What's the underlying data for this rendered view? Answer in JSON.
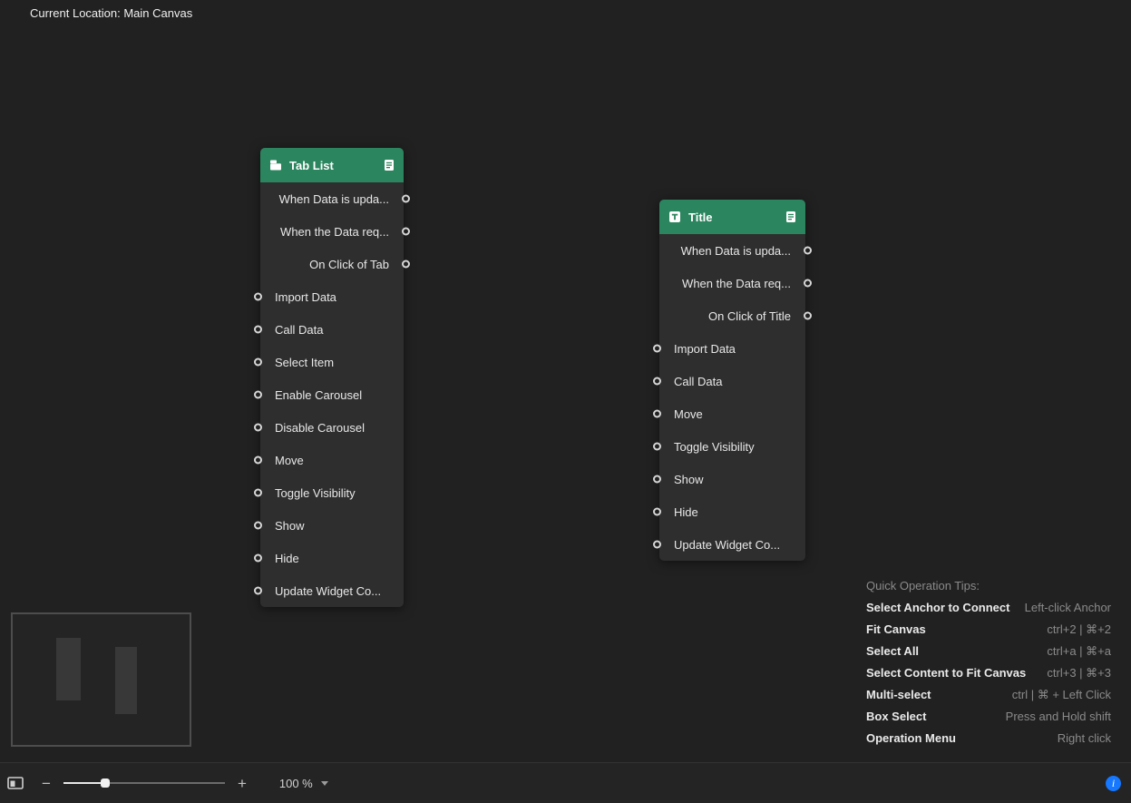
{
  "header": {
    "location": "Current Location: Main Canvas"
  },
  "nodes": [
    {
      "title": "Tab List",
      "icon": "tab-list-icon",
      "detail_icon": "document-icon",
      "outputs": [
        "When Data is upda...",
        "When the Data req...",
        "On Click of Tab"
      ],
      "inputs": [
        "Import Data",
        "Call Data",
        "Select Item",
        "Enable Carousel",
        "Disable Carousel",
        "Move",
        "Toggle Visibility",
        "Show",
        "Hide",
        "Update Widget Co..."
      ]
    },
    {
      "title": "Title",
      "icon": "title-icon",
      "detail_icon": "document-icon",
      "outputs": [
        "When Data is upda...",
        "When the Data req...",
        "On Click of Title"
      ],
      "inputs": [
        "Import Data",
        "Call Data",
        "Move",
        "Toggle Visibility",
        "Show",
        "Hide",
        "Update Widget Co..."
      ]
    }
  ],
  "tips": {
    "title": "Quick Operation Tips:",
    "items": [
      {
        "label": "Select Anchor to Connect",
        "value": "Left-click Anchor"
      },
      {
        "label": "Fit Canvas",
        "value": "ctrl+2 | ⌘+2"
      },
      {
        "label": "Select All",
        "value": "ctrl+a | ⌘+a"
      },
      {
        "label": "Select Content to Fit Canvas",
        "value": "ctrl+3 | ⌘+3"
      },
      {
        "label": "Multi-select",
        "value": "ctrl | ⌘ + Left Click"
      },
      {
        "label": "Box Select",
        "value": "Press and Hold shift"
      },
      {
        "label": "Operation Menu",
        "value": "Right click"
      }
    ]
  },
  "toolbar": {
    "zoom_out": "−",
    "zoom_in": "+",
    "zoom_label": "100 %",
    "info_glyph": "i"
  },
  "colors": {
    "node_header_green": "#2b855e",
    "info_blue": "#1677ff"
  }
}
